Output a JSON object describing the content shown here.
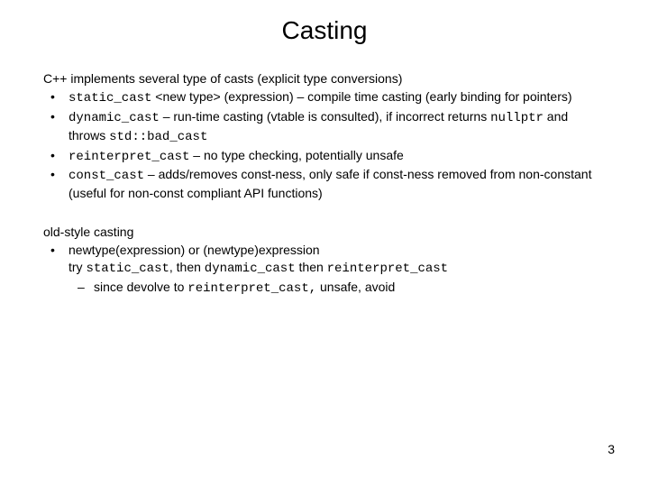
{
  "title": "Casting",
  "intro": "C++ implements several type of casts (explicit type conversions)",
  "bullets": [
    {
      "code": "static_cast",
      "extra": " <new type> (expression)  – compile time casting (early binding for pointers)"
    },
    {
      "code": "dynamic_cast",
      "mid1": " – run-time  casting (vtable is consulted), if incorrect returns ",
      "code2": "nullptr",
      "mid2": " and throws ",
      "code3": "std::bad_cast"
    },
    {
      "code": "reinterpret_cast",
      "extra": " – no type checking, potentially unsafe"
    },
    {
      "code": "const_cast",
      "extra": " – adds/removes const-ness, only safe if const-ness removed from non-constant (useful for non-const compliant API functions)"
    }
  ],
  "old_heading": "old-style casting",
  "old_bullet": {
    "line1": "newtype(expression) or (newtype)expression",
    "pre": "try ",
    "c1": "static_cast",
    "m1": ", then ",
    "c2": "dynamic_cast",
    "m2": " then ",
    "c3": "reinterpret_cast"
  },
  "old_sub": {
    "pre": "since devolve to ",
    "code": "reinterpret_cast,",
    "post": " unsafe, avoid"
  },
  "page_number": "3"
}
